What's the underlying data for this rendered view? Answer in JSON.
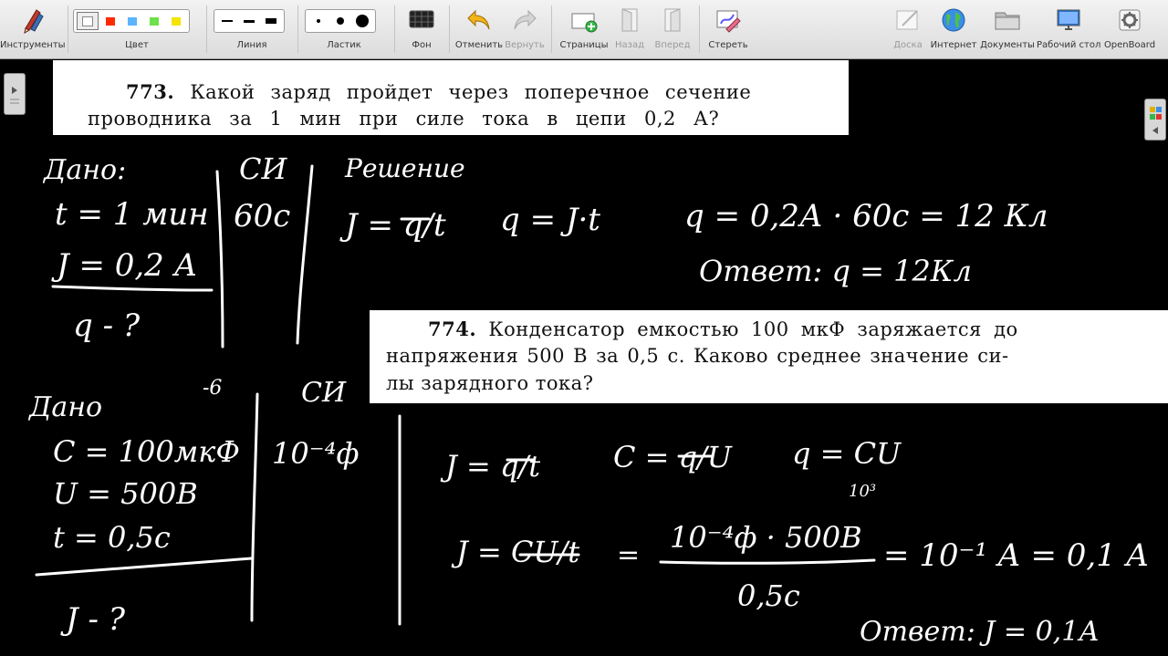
{
  "toolbar": {
    "tools_label": "Инструменты",
    "color_label": "Цвет",
    "line_label": "Линия",
    "eraser_label": "Ластик",
    "background_label": "Фон",
    "undo_label": "Отменить",
    "redo_label": "Вернуть",
    "pages_label": "Страницы",
    "back_label": "Назад",
    "forward_label": "Вперед",
    "clear_label": "Стереть",
    "board_label": "Доска",
    "internet_label": "Интернет",
    "documents_label": "Документы",
    "desktop_label": "Рабочий стол",
    "openboard_label": "OpenBoard"
  },
  "colors": {
    "swatches": [
      "#ffffff",
      "#ff2a00",
      "#5ab4ff",
      "#6de04a",
      "#f4e400"
    ],
    "ink": "#ffffff",
    "toolbar_bg": "#e6e6e6"
  },
  "problem773": {
    "number": "773.",
    "line1": "Какой заряд пройдет через поперечное сечение",
    "line2": "проводника за 1 мин при силе тока в цепи 0,2 А?"
  },
  "problem774": {
    "number": "774.",
    "line1": "Конденсатор емкостью 100 мкФ заряжается до",
    "line2": "напряжения 500 В за 0,5 с. Каково среднее значение си-",
    "line3": "лы зарядного тока?"
  },
  "handwriting773": {
    "given": "Дано:",
    "t": "t = 1 мин",
    "i": "J = 0,2 А",
    "q": "q - ?",
    "si": "СИ",
    "t_si": "60с",
    "solution": "Решение",
    "f1": "J = q/t",
    "f2": "q = J·t",
    "calc": "q = 0,2А · 60с = 12 Кл",
    "answer": "Ответ: q = 12Кл"
  },
  "handwriting774": {
    "given": "Дано",
    "exp": "-6",
    "c": "C = 100мкФ",
    "u": "U = 500В",
    "t": "t = 0,5с",
    "i": "J - ?",
    "si": "СИ",
    "c_si": "10⁻⁴ф",
    "f1": "J = q/t",
    "f2": "C = q/U",
    "f3": "q = CU",
    "f3b": "10³",
    "f4": "J = CU/t",
    "num": "10⁻⁴ф · 500В",
    "den": "0,5с",
    "res": "= 10⁻¹ А = 0,1 А",
    "answer": "Ответ: J = 0,1А"
  }
}
